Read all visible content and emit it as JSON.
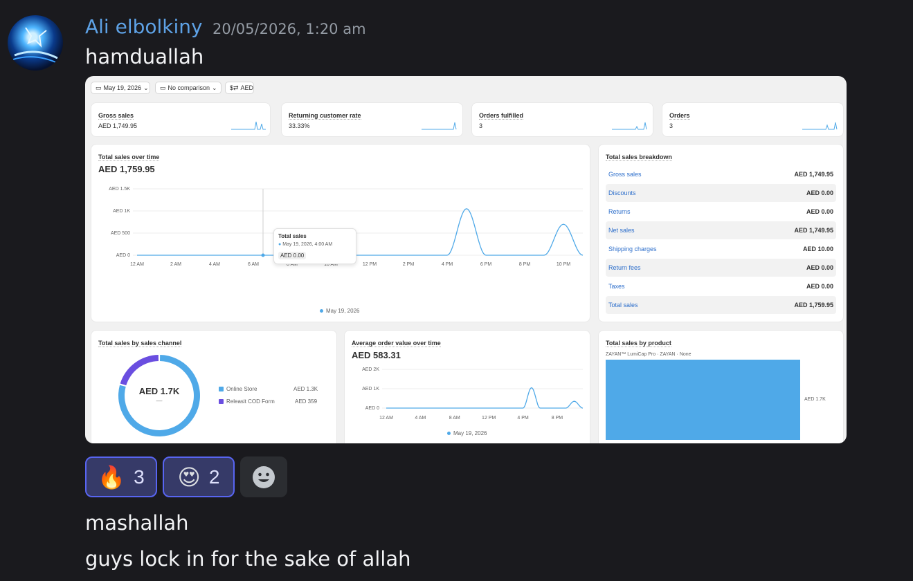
{
  "message": {
    "author": "Ali elbolkiny",
    "timestamp": "20/05/2026, 1:20 am",
    "text1": "hamduallah",
    "text2": "mashallah",
    "text3": "guys lock in for the sake of allah"
  },
  "reactions": [
    {
      "emoji": "🔥",
      "icon": "fire-icon",
      "count": "3"
    },
    {
      "emoji": "😍",
      "icon": "heart-eyes-icon",
      "count": "2"
    }
  ],
  "add_reaction_icon": "smiley-add-icon",
  "dashboard": {
    "filters": {
      "date": "May 19, 2026",
      "comparison": "No comparison",
      "currency": "AED",
      "currency_icon": "$⇄"
    },
    "kpis": [
      {
        "label": "Gross sales",
        "value": "AED 1,749.95"
      },
      {
        "label": "Returning customer rate",
        "value": "33.33%"
      },
      {
        "label": "Orders fulfilled",
        "value": "3"
      },
      {
        "label": "Orders",
        "value": "3"
      }
    ],
    "sales_over_time": {
      "title": "Total sales over time",
      "total": "AED 1,759.95",
      "legend": "May 19, 2026",
      "tooltip": {
        "title": "Total sales",
        "date": "May 19, 2026, 4:00 AM",
        "value": "AED 0.00"
      }
    },
    "breakdown": {
      "title": "Total sales breakdown",
      "rows": [
        {
          "label": "Gross sales",
          "value": "AED 1,749.95"
        },
        {
          "label": "Discounts",
          "value": "AED 0.00"
        },
        {
          "label": "Returns",
          "value": "AED 0.00"
        },
        {
          "label": "Net sales",
          "value": "AED 1,749.95"
        },
        {
          "label": "Shipping charges",
          "value": "AED 10.00"
        },
        {
          "label": "Return fees",
          "value": "AED 0.00"
        },
        {
          "label": "Taxes",
          "value": "AED 0.00"
        },
        {
          "label": "Total sales",
          "value": "AED 1,759.95"
        }
      ]
    },
    "by_channel": {
      "title": "Total sales by sales channel",
      "center_value": "AED 1.7K",
      "center_sub": "—",
      "channels": [
        {
          "name": "Online Store",
          "value": "AED 1.3K",
          "color": "#4fa9e8"
        },
        {
          "name": "Releasit COD Form",
          "value": "AED 359",
          "color": "#6a4ee0"
        }
      ]
    },
    "aov": {
      "title": "Average order value over time",
      "total": "AED 583.31",
      "legend": "May 19, 2026"
    },
    "by_product": {
      "title": "Total sales by product",
      "product": "ZAYAN™ LumiCap Pro · ZAYAN · None",
      "value_label": "AED 1.7K"
    },
    "colors": {
      "line": "#4fa9e8",
      "donut_primary": "#4fa9e8",
      "donut_secondary": "#6a4ee0",
      "bar": "#4fa9e8"
    }
  },
  "chart_data": [
    {
      "type": "line",
      "title": "Total sales over time",
      "x": [
        "12 AM",
        "2 AM",
        "4 AM",
        "6 AM",
        "8 AM",
        "10 AM",
        "12 PM",
        "2 PM",
        "4 PM",
        "6 PM",
        "8 PM",
        "10 PM"
      ],
      "ylim": [
        0,
        1500
      ],
      "yticks": [
        "AED 0",
        "AED 500",
        "AED 1K",
        "AED 1.5K"
      ],
      "series": [
        {
          "name": "May 19, 2026",
          "points": [
            [
              0,
              0
            ],
            [
              16,
              0
            ],
            [
              17,
              1050
            ],
            [
              18,
              0
            ],
            [
              21,
              0
            ],
            [
              22,
              700
            ],
            [
              23,
              0
            ]
          ]
        }
      ]
    },
    {
      "type": "line",
      "title": "Average order value over time",
      "x": [
        "12 AM",
        "4 AM",
        "8 AM",
        "12 PM",
        "4 PM",
        "8 PM"
      ],
      "ylim": [
        0,
        2000
      ],
      "yticks": [
        "AED 0",
        "AED 1K",
        "AED 2K"
      ],
      "series": [
        {
          "name": "May 19, 2026",
          "points": [
            [
              0,
              0
            ],
            [
              16,
              0
            ],
            [
              17,
              1050
            ],
            [
              18,
              0
            ],
            [
              21,
              0
            ],
            [
              22,
              350
            ],
            [
              23,
              0
            ]
          ]
        }
      ]
    },
    {
      "type": "pie",
      "title": "Total sales by sales channel",
      "labels": [
        "Online Store",
        "Releasit COD Form"
      ],
      "values": [
        1391,
        359
      ]
    },
    {
      "type": "bar",
      "title": "Total sales by product",
      "categories": [
        "ZAYAN™ LumiCap Pro · ZAYAN · None"
      ],
      "values": [
        1749.95
      ]
    }
  ]
}
